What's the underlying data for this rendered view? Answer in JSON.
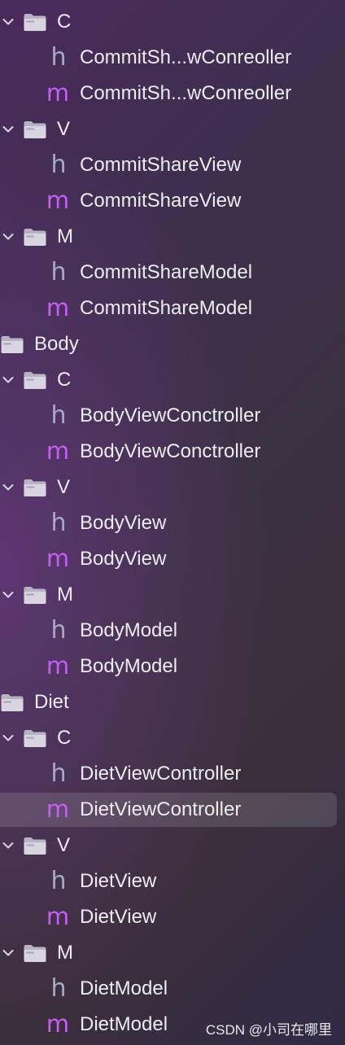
{
  "navigator": {
    "rows": [
      {
        "type": "group",
        "label": "C",
        "expanded": true
      },
      {
        "type": "file",
        "kind": "h",
        "label": "CommitSh...wConreoller"
      },
      {
        "type": "file",
        "kind": "m",
        "label": "CommitSh...wConreoller"
      },
      {
        "type": "group",
        "label": "V",
        "expanded": true
      },
      {
        "type": "file",
        "kind": "h",
        "label": "CommitShareView"
      },
      {
        "type": "file",
        "kind": "m",
        "label": "CommitShareView"
      },
      {
        "type": "group",
        "label": "M",
        "expanded": true
      },
      {
        "type": "file",
        "kind": "h",
        "label": "CommitShareModel"
      },
      {
        "type": "file",
        "kind": "m",
        "label": "CommitShareModel"
      },
      {
        "type": "topgroup",
        "label": "Body"
      },
      {
        "type": "group",
        "label": "C",
        "expanded": true
      },
      {
        "type": "file",
        "kind": "h",
        "label": "BodyViewConctroller"
      },
      {
        "type": "file",
        "kind": "m",
        "label": "BodyViewConctroller"
      },
      {
        "type": "group",
        "label": "V",
        "expanded": true
      },
      {
        "type": "file",
        "kind": "h",
        "label": "BodyView"
      },
      {
        "type": "file",
        "kind": "m",
        "label": "BodyView"
      },
      {
        "type": "group",
        "label": "M",
        "expanded": true
      },
      {
        "type": "file",
        "kind": "h",
        "label": "BodyModel"
      },
      {
        "type": "file",
        "kind": "m",
        "label": "BodyModel"
      },
      {
        "type": "topgroup",
        "label": "Diet"
      },
      {
        "type": "group",
        "label": "C",
        "expanded": true
      },
      {
        "type": "file",
        "kind": "h",
        "label": "DietViewController"
      },
      {
        "type": "file",
        "kind": "m",
        "label": "DietViewController",
        "selected": true
      },
      {
        "type": "group",
        "label": "V",
        "expanded": true
      },
      {
        "type": "file",
        "kind": "h",
        "label": "DietView"
      },
      {
        "type": "file",
        "kind": "m",
        "label": "DietView"
      },
      {
        "type": "group",
        "label": "M",
        "expanded": true
      },
      {
        "type": "file",
        "kind": "h",
        "label": "DietModel"
      },
      {
        "type": "file",
        "kind": "m",
        "label": "DietModel"
      }
    ]
  },
  "icons": {
    "h_glyph": "h",
    "m_glyph": "m",
    "h_color": "#a6aac8",
    "m_color": "#c65ef6",
    "folder_color": "#b7b3c2"
  },
  "watermark": {
    "text": "CSDN @小司在哪里"
  }
}
